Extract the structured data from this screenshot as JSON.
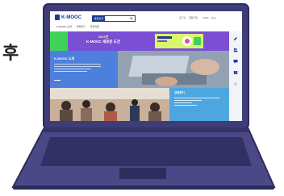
{
  "side_label": "후",
  "site": {
    "logo_text": "K-MOOC",
    "search_select": "통합검색",
    "util_links": [
      "로그인",
      "회원가입",
      "ENG",
      "Eng"
    ],
    "nav_items": [
      "K-MOOC 소개",
      "강좌찾기",
      "학습지원"
    ],
    "banner_title": "2022년",
    "banner_subtitle": "K-MOOC 새로운 도전",
    "card_title": "K-MOOC 소개",
    "card_light_title": "강좌찾기"
  },
  "colors": {
    "brand": "#1a3b8f",
    "banner_purple": "#7a4fd4",
    "banner_green": "#3fd25b",
    "banner_lime": "#d9f56a",
    "card_blue": "#4d7fdc",
    "laptop_body": "#3f3d78"
  },
  "icons": [
    "search-icon",
    "sidebar-pencil-icon",
    "sidebar-people-icon",
    "sidebar-chat-icon",
    "sidebar-book-icon"
  ]
}
